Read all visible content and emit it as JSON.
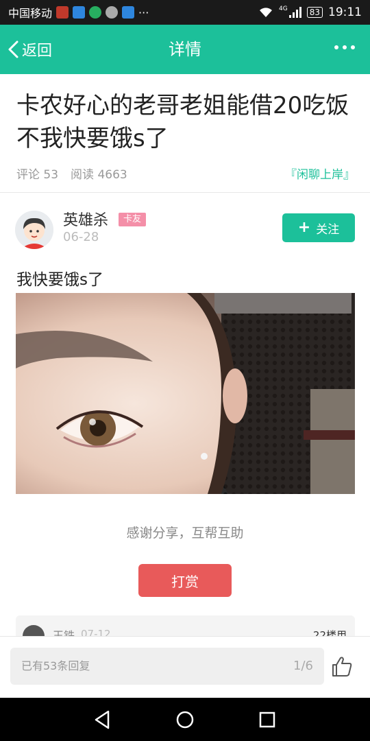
{
  "status_bar": {
    "carrier": "中国移动",
    "network": "4G",
    "battery": "83",
    "time": "19:11",
    "more": "···"
  },
  "header": {
    "back_label": "返回",
    "title": "详情"
  },
  "post": {
    "title": "卡农好心的老哥老姐能借20吃饭不我快要饿s了",
    "comments_label": "评论 53",
    "views_label": "阅读 4663",
    "board_tag": "『闲聊上岸』",
    "body": "我快要饿s了"
  },
  "author": {
    "name": "英雄杀",
    "badge": "卡友",
    "date": "06-28",
    "follow_label": "关注"
  },
  "thanks_text": "感谢分享，互帮互助",
  "reward_label": "打赏",
  "comment_peek": {
    "name": "王铁",
    "date": "07-12",
    "floor": "22楼用"
  },
  "bottom_bar": {
    "reply_placeholder": "已有53条回复",
    "page_indicator": "1/6"
  },
  "colors": {
    "accent": "#1cc09a",
    "reward": "#e85a5a",
    "badge": "#f48fa8"
  }
}
